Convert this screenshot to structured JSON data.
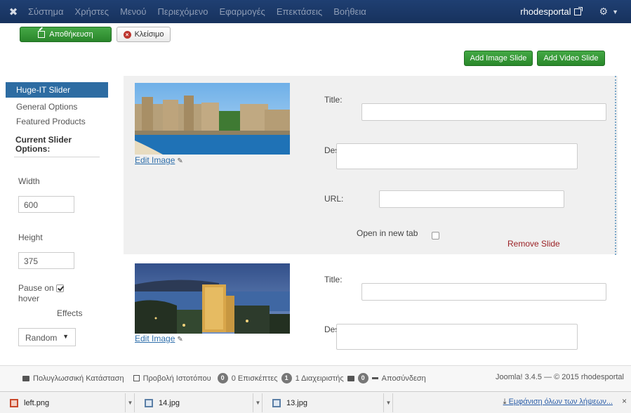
{
  "topnav": {
    "menu": [
      "Σύστημα",
      "Χρήστες",
      "Μενού",
      "Περιεχόμενο",
      "Εφαρμογές",
      "Επεκτάσεις",
      "Βοήθεια"
    ],
    "site_name": "rhodesportal"
  },
  "toolbar": {
    "save_label": "Αποθήκευση",
    "close_label": "Κλείσιμο"
  },
  "actions": {
    "add_image": "Add Image Slide",
    "add_video": "Add Video Slide"
  },
  "sidebar": {
    "active_item": "Huge-IT Slider",
    "items": [
      "General Options",
      "Featured Products"
    ],
    "heading": "Current Slider Options:",
    "width_label": "Width",
    "width_value": "600",
    "height_label": "Height",
    "height_value": "375",
    "pause_label_1": "Pause on",
    "pause_label_2": "hover",
    "pause_checked": true,
    "effects_label": "Effects",
    "effects_value": "Random"
  },
  "slides": {
    "edit_image": "Edit Image",
    "title_label": "Title:",
    "description_label": "Description:",
    "url_label": "URL:",
    "open_new_tab": "Open in new tab",
    "remove_slide": "Remove Slide"
  },
  "statusbar": {
    "multilingual": "Πολυγλωσσική Κατάσταση",
    "view_site": "Προβολή Ιστοτόπου",
    "visitors_count": "0",
    "visitors_label": "0 Επισκέπτες",
    "admins_count": "1",
    "admins_label": "1 Διαχειριστής",
    "messages_count": "0",
    "logout": "Αποσύνδεση",
    "version": "Joomla! 3.4.5 — © 2015 rhodesportal"
  },
  "downloads": {
    "files": [
      "left.png",
      "14.jpg",
      "13.jpg"
    ],
    "show_all": "Εμφάνιση όλων των λήψεων..."
  },
  "colors": {
    "nav_bg": "#1a3867",
    "green": "#2e8f30",
    "accent_blue": "#2d6ca2",
    "remove_red": "#9b2226"
  }
}
